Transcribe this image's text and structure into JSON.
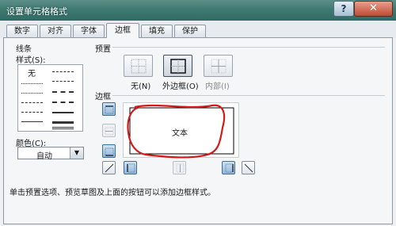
{
  "window": {
    "title": "设置单元格格式",
    "help_label": "?",
    "close_label": "✕"
  },
  "tabs": [
    {
      "label": "数字"
    },
    {
      "label": "对齐"
    },
    {
      "label": "字体"
    },
    {
      "label": "边框"
    },
    {
      "label": "填充"
    },
    {
      "label": "保护"
    }
  ],
  "active_tab": "边框",
  "line": {
    "section_label": "线条",
    "style_label": "样式(S):",
    "none_label": "无",
    "color_label": "颜色(C):",
    "color_value": "自动"
  },
  "presets": {
    "section_label": "预置",
    "items": [
      {
        "label": "无(N)"
      },
      {
        "label": "外边框(O)"
      },
      {
        "label": "内部(I)"
      }
    ]
  },
  "border": {
    "section_label": "边框",
    "preview_text": "文本"
  },
  "hint": "单击预置选项、预览草图及上面的按钮可以添加边框样式。",
  "colors": {
    "title_bar": "#3f7a73",
    "annotation": "#d11a1a"
  }
}
